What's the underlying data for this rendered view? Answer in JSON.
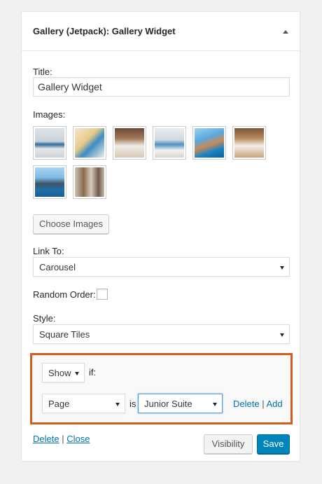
{
  "widget": {
    "title": "Gallery (Jetpack): Gallery Widget"
  },
  "form": {
    "title_label": "Title:",
    "title_value": "Gallery Widget",
    "images_label": "Images:",
    "choose_images": "Choose Images",
    "link_to_label": "Link To:",
    "link_to_value": "Carousel",
    "random_order_label": "Random Order:",
    "random_order_checked": false,
    "style_label": "Style:",
    "style_value": "Square Tiles"
  },
  "visibility_rules": {
    "action": "Show",
    "if_label": "if:",
    "rule_major": "Page",
    "is_label": "is",
    "rule_minor": "Junior Suite",
    "delete": "Delete",
    "separator": "|",
    "add": "Add"
  },
  "footer": {
    "delete": "Delete",
    "separator": "|",
    "close": "Close",
    "visibility": "Visibility",
    "save": "Save"
  },
  "colors": {
    "highlight_border": "#d35c1f",
    "primary_button": "#0085ba",
    "link": "#0073aa"
  }
}
